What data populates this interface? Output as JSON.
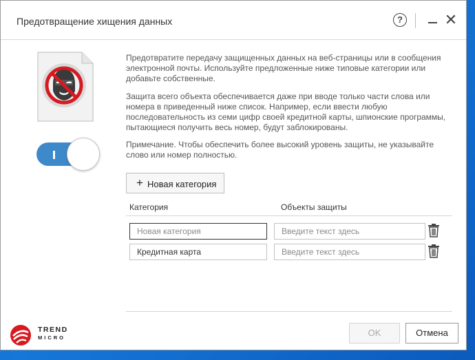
{
  "window": {
    "title": "Предотвращение хищения данных",
    "help_symbol": "?",
    "close_symbol": "✕"
  },
  "toggle": {
    "state": "on"
  },
  "description": {
    "p1": "Предотвратите передачу защищенных данных на веб-страницы или в сообщения электронной почты. Используйте предложенные ниже типовые категории или добавьте собственные.",
    "p2": "Защита всего объекта обеспечивается даже при вводе только части слова или номера в приведенный ниже список. Например, если ввести любую последовательность из семи цифр своей кредитной карты, шпионские программы, пытающиеся получить весь номер, будут заблокированы.",
    "p3": "Примечание. Чтобы обеспечить более высокий уровень защиты, не указывайте слово или номер полностью."
  },
  "add_button": {
    "plus": "+",
    "label": "Новая категория"
  },
  "table": {
    "headers": {
      "category": "Категория",
      "objects": "Объекты защиты"
    },
    "rows": [
      {
        "category_value": "",
        "category_placeholder": "Новая категория",
        "object_value": "",
        "object_placeholder": "Введите текст здесь"
      },
      {
        "category_value": "Кредитная карта",
        "category_placeholder": "",
        "object_value": "",
        "object_placeholder": "Введите текст здесь"
      }
    ]
  },
  "footer": {
    "logo_line1": "TREND",
    "logo_line2": "MICRO",
    "ok_label": "OK",
    "cancel_label": "Отмена"
  },
  "colors": {
    "accent": "#3d89c9",
    "brand_red": "#d71920",
    "desktop": "#1677d8"
  },
  "icons": [
    "help-icon",
    "minimize-icon",
    "close-icon",
    "data-theft-icon",
    "plus-icon",
    "trash-icon",
    "trend-micro-logo-icon"
  ]
}
